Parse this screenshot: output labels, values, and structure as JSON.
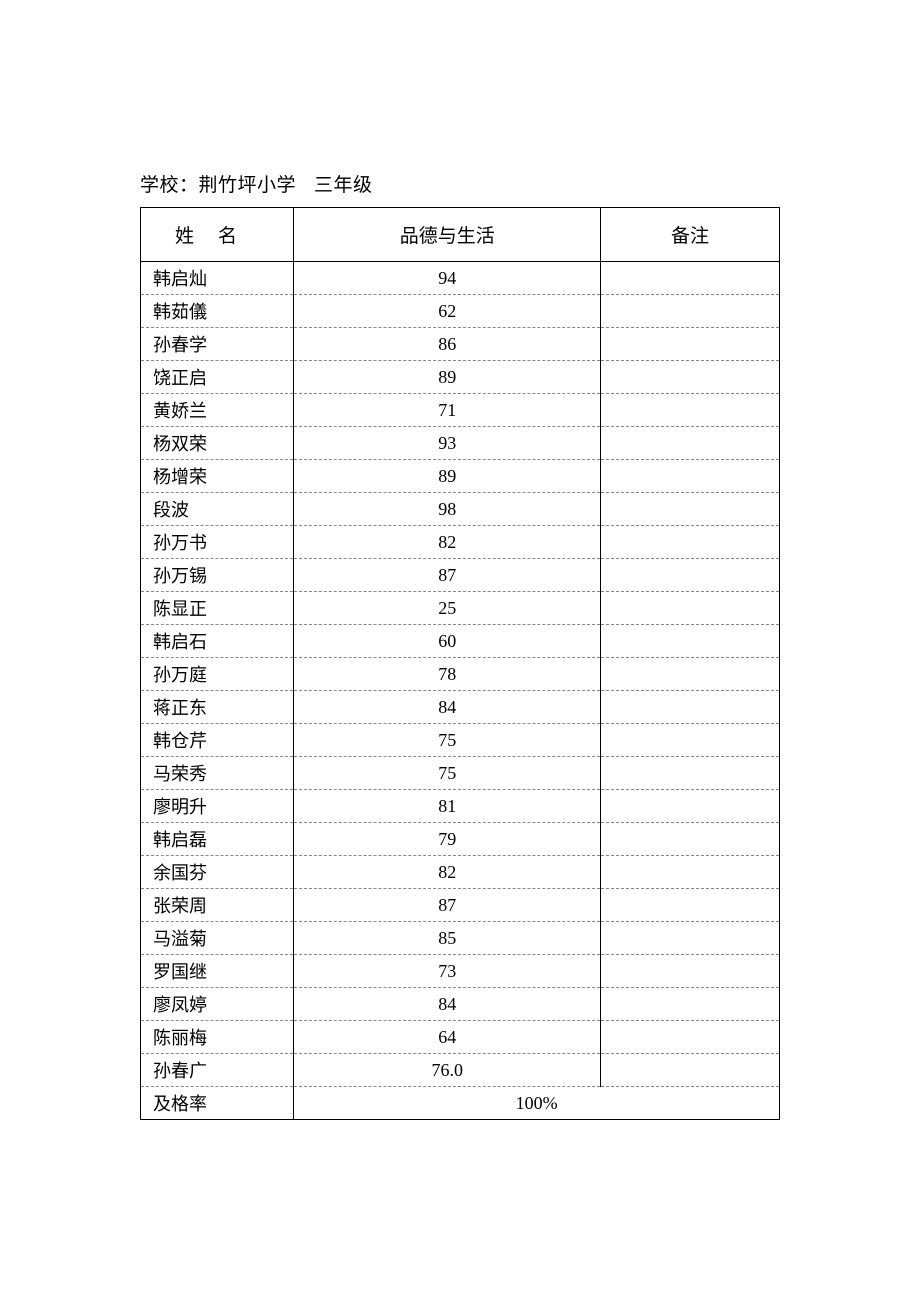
{
  "heading": {
    "label_school": "学校：",
    "school_name": "荆竹坪小学",
    "grade": "三年级"
  },
  "headers": {
    "name": "姓名",
    "score": "品德与生活",
    "note": "备注"
  },
  "rows": [
    {
      "name": "韩启灿",
      "score": "94",
      "note": ""
    },
    {
      "name": "韩茹儀",
      "score": "62",
      "note": ""
    },
    {
      "name": "孙春学",
      "score": "86",
      "note": ""
    },
    {
      "name": "饶正启",
      "score": "89",
      "note": ""
    },
    {
      "name": "黄娇兰",
      "score": "71",
      "note": ""
    },
    {
      "name": "杨双荣",
      "score": "93",
      "note": ""
    },
    {
      "name": "杨增荣",
      "score": "89",
      "note": ""
    },
    {
      "name": "段波",
      "score": "98",
      "note": ""
    },
    {
      "name": "孙万书",
      "score": "82",
      "note": ""
    },
    {
      "name": "孙万锡",
      "score": "87",
      "note": ""
    },
    {
      "name": "陈显正",
      "score": "25",
      "note": ""
    },
    {
      "name": "韩启石",
      "score": "60",
      "note": ""
    },
    {
      "name": "孙万庭",
      "score": "78",
      "note": ""
    },
    {
      "name": "蒋正东",
      "score": "84",
      "note": ""
    },
    {
      "name": "韩仓芹",
      "score": "75",
      "note": ""
    },
    {
      "name": "马荣秀",
      "score": "75",
      "note": ""
    },
    {
      "name": "廖明升",
      "score": "81",
      "note": ""
    },
    {
      "name": "韩启磊",
      "score": "79",
      "note": ""
    },
    {
      "name": "余国芬",
      "score": "82",
      "note": ""
    },
    {
      "name": "张荣周",
      "score": "87",
      "note": ""
    },
    {
      "name": "马溢菊",
      "score": "85",
      "note": ""
    },
    {
      "name": "罗国继",
      "score": "73",
      "note": ""
    },
    {
      "name": "廖凤婷",
      "score": "84",
      "note": ""
    },
    {
      "name": "陈丽梅",
      "score": "64",
      "note": ""
    },
    {
      "name": "孙春广",
      "score": "76.0",
      "note": ""
    }
  ],
  "pass_rate": {
    "label": "及格率",
    "value": "100%"
  }
}
